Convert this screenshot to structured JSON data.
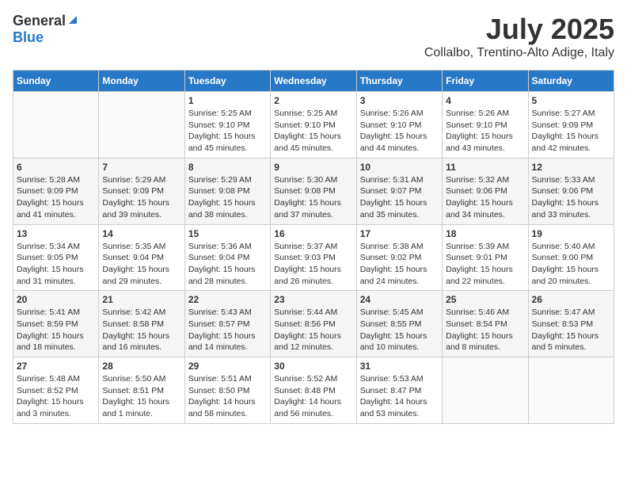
{
  "header": {
    "logo_general": "General",
    "logo_blue": "Blue",
    "month": "July 2025",
    "location": "Collalbo, Trentino-Alto Adige, Italy"
  },
  "days_of_week": [
    "Sunday",
    "Monday",
    "Tuesday",
    "Wednesday",
    "Thursday",
    "Friday",
    "Saturday"
  ],
  "weeks": [
    [
      {
        "day": "",
        "info": ""
      },
      {
        "day": "",
        "info": ""
      },
      {
        "day": "1",
        "info": "Sunrise: 5:25 AM\nSunset: 9:10 PM\nDaylight: 15 hours and 45 minutes."
      },
      {
        "day": "2",
        "info": "Sunrise: 5:25 AM\nSunset: 9:10 PM\nDaylight: 15 hours and 45 minutes."
      },
      {
        "day": "3",
        "info": "Sunrise: 5:26 AM\nSunset: 9:10 PM\nDaylight: 15 hours and 44 minutes."
      },
      {
        "day": "4",
        "info": "Sunrise: 5:26 AM\nSunset: 9:10 PM\nDaylight: 15 hours and 43 minutes."
      },
      {
        "day": "5",
        "info": "Sunrise: 5:27 AM\nSunset: 9:09 PM\nDaylight: 15 hours and 42 minutes."
      }
    ],
    [
      {
        "day": "6",
        "info": "Sunrise: 5:28 AM\nSunset: 9:09 PM\nDaylight: 15 hours and 41 minutes."
      },
      {
        "day": "7",
        "info": "Sunrise: 5:29 AM\nSunset: 9:09 PM\nDaylight: 15 hours and 39 minutes."
      },
      {
        "day": "8",
        "info": "Sunrise: 5:29 AM\nSunset: 9:08 PM\nDaylight: 15 hours and 38 minutes."
      },
      {
        "day": "9",
        "info": "Sunrise: 5:30 AM\nSunset: 9:08 PM\nDaylight: 15 hours and 37 minutes."
      },
      {
        "day": "10",
        "info": "Sunrise: 5:31 AM\nSunset: 9:07 PM\nDaylight: 15 hours and 35 minutes."
      },
      {
        "day": "11",
        "info": "Sunrise: 5:32 AM\nSunset: 9:06 PM\nDaylight: 15 hours and 34 minutes."
      },
      {
        "day": "12",
        "info": "Sunrise: 5:33 AM\nSunset: 9:06 PM\nDaylight: 15 hours and 33 minutes."
      }
    ],
    [
      {
        "day": "13",
        "info": "Sunrise: 5:34 AM\nSunset: 9:05 PM\nDaylight: 15 hours and 31 minutes."
      },
      {
        "day": "14",
        "info": "Sunrise: 5:35 AM\nSunset: 9:04 PM\nDaylight: 15 hours and 29 minutes."
      },
      {
        "day": "15",
        "info": "Sunrise: 5:36 AM\nSunset: 9:04 PM\nDaylight: 15 hours and 28 minutes."
      },
      {
        "day": "16",
        "info": "Sunrise: 5:37 AM\nSunset: 9:03 PM\nDaylight: 15 hours and 26 minutes."
      },
      {
        "day": "17",
        "info": "Sunrise: 5:38 AM\nSunset: 9:02 PM\nDaylight: 15 hours and 24 minutes."
      },
      {
        "day": "18",
        "info": "Sunrise: 5:39 AM\nSunset: 9:01 PM\nDaylight: 15 hours and 22 minutes."
      },
      {
        "day": "19",
        "info": "Sunrise: 5:40 AM\nSunset: 9:00 PM\nDaylight: 15 hours and 20 minutes."
      }
    ],
    [
      {
        "day": "20",
        "info": "Sunrise: 5:41 AM\nSunset: 8:59 PM\nDaylight: 15 hours and 18 minutes."
      },
      {
        "day": "21",
        "info": "Sunrise: 5:42 AM\nSunset: 8:58 PM\nDaylight: 15 hours and 16 minutes."
      },
      {
        "day": "22",
        "info": "Sunrise: 5:43 AM\nSunset: 8:57 PM\nDaylight: 15 hours and 14 minutes."
      },
      {
        "day": "23",
        "info": "Sunrise: 5:44 AM\nSunset: 8:56 PM\nDaylight: 15 hours and 12 minutes."
      },
      {
        "day": "24",
        "info": "Sunrise: 5:45 AM\nSunset: 8:55 PM\nDaylight: 15 hours and 10 minutes."
      },
      {
        "day": "25",
        "info": "Sunrise: 5:46 AM\nSunset: 8:54 PM\nDaylight: 15 hours and 8 minutes."
      },
      {
        "day": "26",
        "info": "Sunrise: 5:47 AM\nSunset: 8:53 PM\nDaylight: 15 hours and 5 minutes."
      }
    ],
    [
      {
        "day": "27",
        "info": "Sunrise: 5:48 AM\nSunset: 8:52 PM\nDaylight: 15 hours and 3 minutes."
      },
      {
        "day": "28",
        "info": "Sunrise: 5:50 AM\nSunset: 8:51 PM\nDaylight: 15 hours and 1 minute."
      },
      {
        "day": "29",
        "info": "Sunrise: 5:51 AM\nSunset: 8:50 PM\nDaylight: 14 hours and 58 minutes."
      },
      {
        "day": "30",
        "info": "Sunrise: 5:52 AM\nSunset: 8:48 PM\nDaylight: 14 hours and 56 minutes."
      },
      {
        "day": "31",
        "info": "Sunrise: 5:53 AM\nSunset: 8:47 PM\nDaylight: 14 hours and 53 minutes."
      },
      {
        "day": "",
        "info": ""
      },
      {
        "day": "",
        "info": ""
      }
    ]
  ]
}
